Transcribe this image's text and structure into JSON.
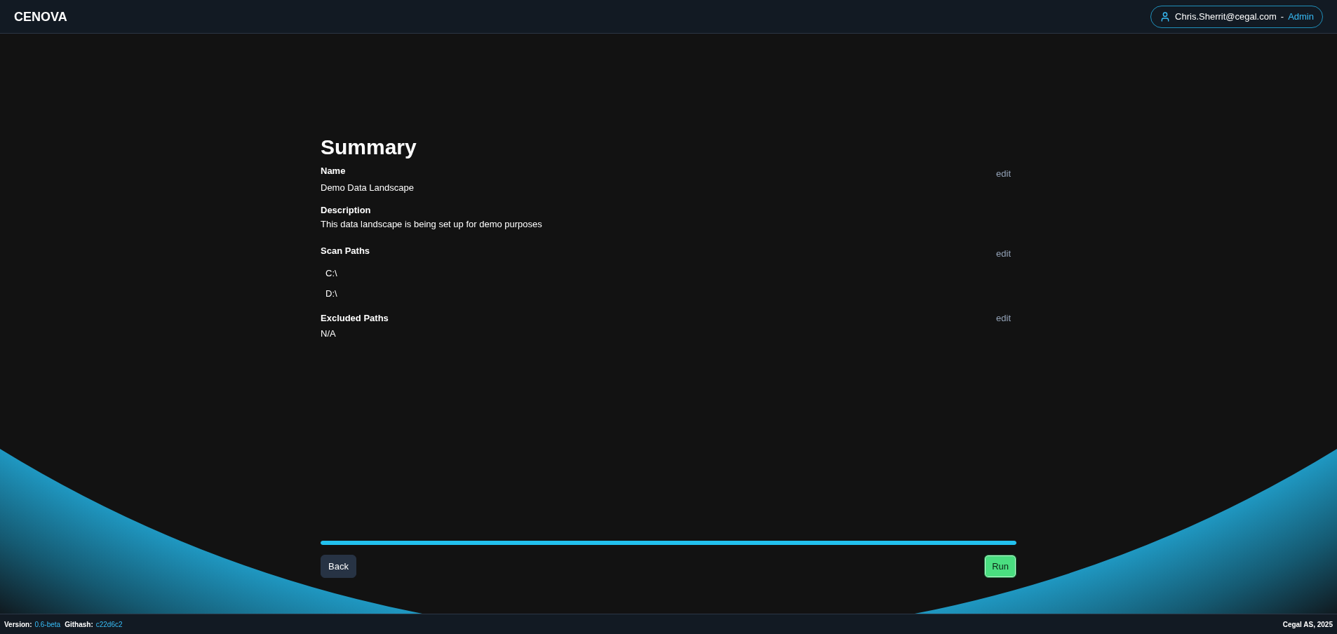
{
  "header": {
    "logo": "CENOVA",
    "user": {
      "email": "Chris.Sherrit@cegal.com",
      "separator": "-",
      "role": "Admin"
    }
  },
  "summary": {
    "title": "Summary",
    "fields": [
      {
        "label": "Name",
        "edit": "edit",
        "value": "Demo Data Landscape"
      },
      {
        "label": "Description",
        "value": "This data landscape is being set up for demo purposes"
      }
    ],
    "path_groups": [
      {
        "label": "Scan Paths",
        "edit": "edit",
        "paths": [
          "C:\\",
          "D:\\"
        ]
      },
      {
        "label": "Excluded Paths",
        "edit": "edit",
        "value": "N/A"
      }
    ]
  },
  "progress": {
    "level": 1
  },
  "buttons": [
    {
      "label": "Back",
      "kind": "secondary"
    },
    {
      "label": "Run",
      "kind": "primary"
    }
  ],
  "footer": {
    "version_label": "Version:",
    "version": "0.6-beta",
    "githash_label": "Githash:",
    "githash": "c22d6c2",
    "copyright": "Cegal AS, 2025"
  }
}
